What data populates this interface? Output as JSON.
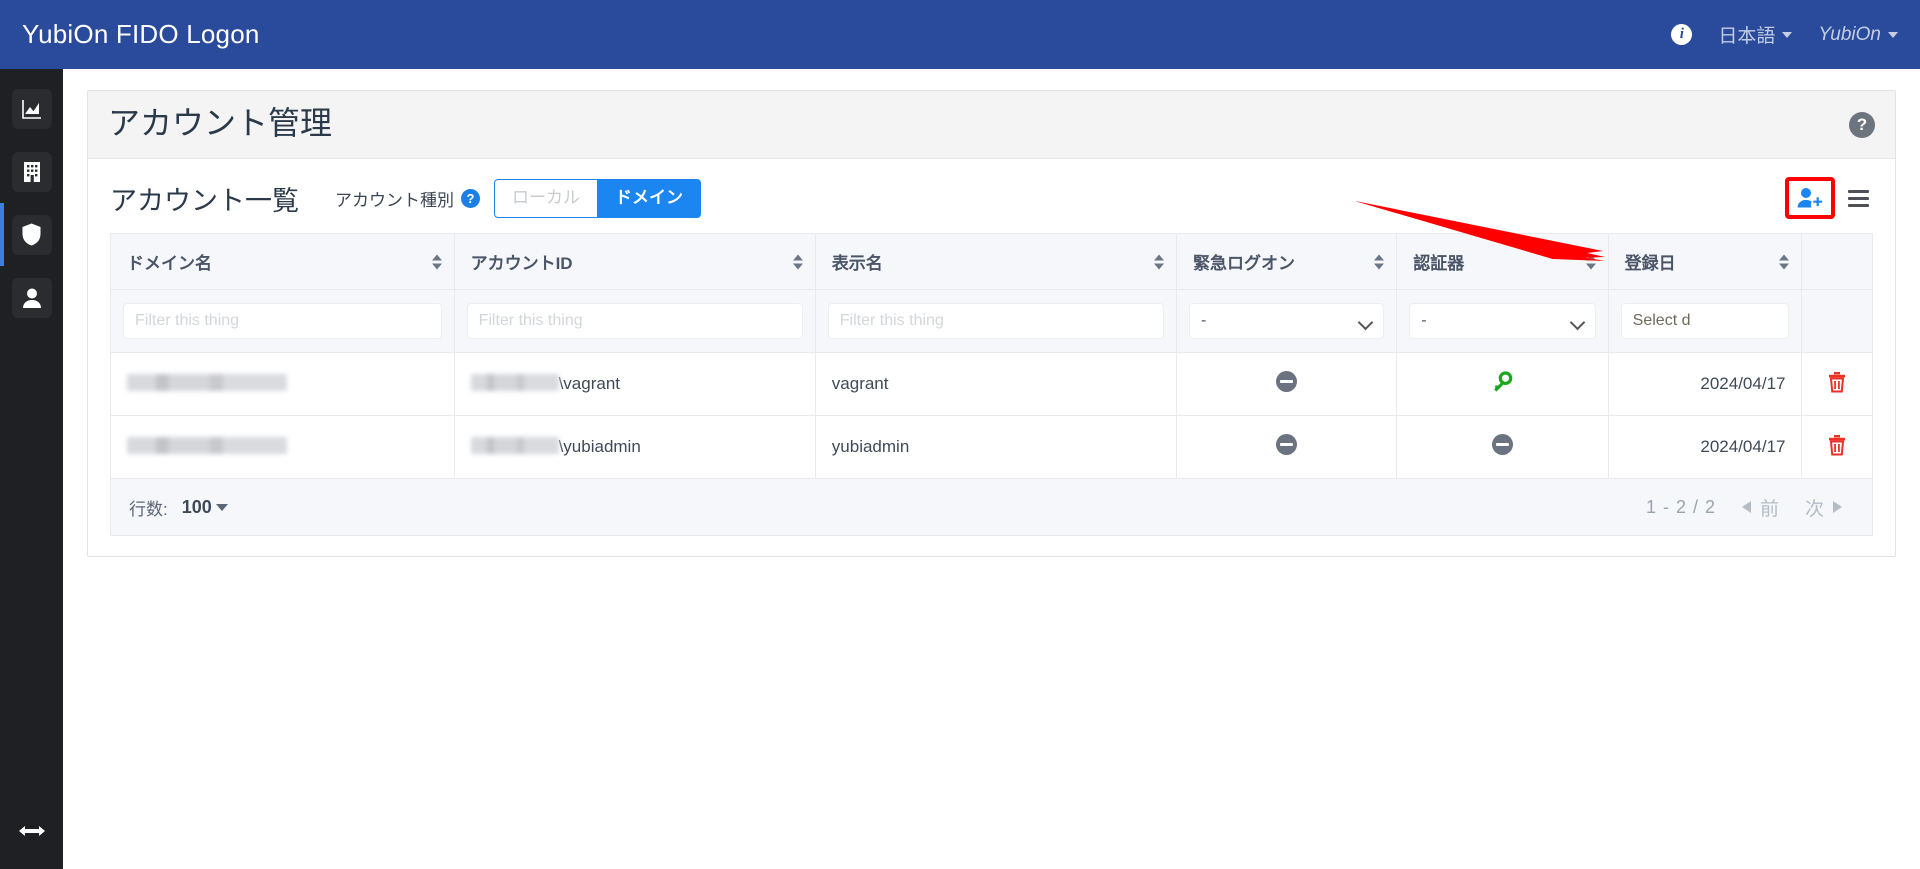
{
  "topbar": {
    "brand": "YubiOn FIDO Logon",
    "info_icon": "info-icon",
    "language": "日本語",
    "account": "YubiOn"
  },
  "sidebar": {
    "items": [
      {
        "name": "dashboard",
        "icon": "chart-area-icon"
      },
      {
        "name": "organization",
        "icon": "building-icon"
      },
      {
        "name": "security",
        "icon": "shield-icon",
        "active": true
      },
      {
        "name": "accounts",
        "icon": "user-icon"
      }
    ],
    "collapse_toggle": {
      "name": "collapse-sidebar",
      "icon": "arrows-left-right-icon"
    }
  },
  "page": {
    "title": "アカウント管理",
    "help_label": "?"
  },
  "list": {
    "heading": "アカウント一覧",
    "account_type_label": "アカウント種別",
    "account_type_help": "?",
    "toggle": [
      {
        "label": "ローカル",
        "active": false
      },
      {
        "label": "ドメイン",
        "active": true
      }
    ],
    "add_user_icon": "user-plus-icon",
    "menu_icon": "hamburger-menu-icon",
    "highlight_color": "#ff0000"
  },
  "table": {
    "columns": [
      {
        "label": "ドメイン名",
        "sortable": true
      },
      {
        "label": "アカウントID",
        "sortable": true
      },
      {
        "label": "表示名",
        "sortable": true
      },
      {
        "label": "緊急ログオン",
        "sortable": true
      },
      {
        "label": "認証器",
        "sortable": true
      },
      {
        "label": "登録日",
        "sortable": true
      },
      {
        "label": "",
        "sortable": false
      }
    ],
    "filters": {
      "domain_placeholder": "Filter this thing",
      "account_id_placeholder": "Filter this thing",
      "display_name_placeholder": "Filter this thing",
      "emergency_logon_value": "-",
      "authenticator_value": "-",
      "registered_date_placeholder": "Select d"
    },
    "rows": [
      {
        "domain": "",
        "domain_redacted": true,
        "account_id_prefix_redacted": true,
        "account_id_suffix": "\\vagrant",
        "display_name": "vagrant",
        "emergency_logon": "minus-circle-icon",
        "authenticator": "key-icon",
        "registered_date": "2024/04/17",
        "delete_icon": "trash-icon"
      },
      {
        "domain": "",
        "domain_redacted": true,
        "account_id_prefix_redacted": true,
        "account_id_suffix": "\\yubiadmin",
        "display_name": "yubiadmin",
        "emergency_logon": "minus-circle-icon",
        "authenticator": "minus-circle-icon",
        "registered_date": "2024/04/17",
        "delete_icon": "trash-icon"
      }
    ]
  },
  "footer": {
    "rows_label": "行数:",
    "rows_value": "100",
    "range": "1 - 2 / 2",
    "prev_label": "前",
    "next_label": "次"
  }
}
